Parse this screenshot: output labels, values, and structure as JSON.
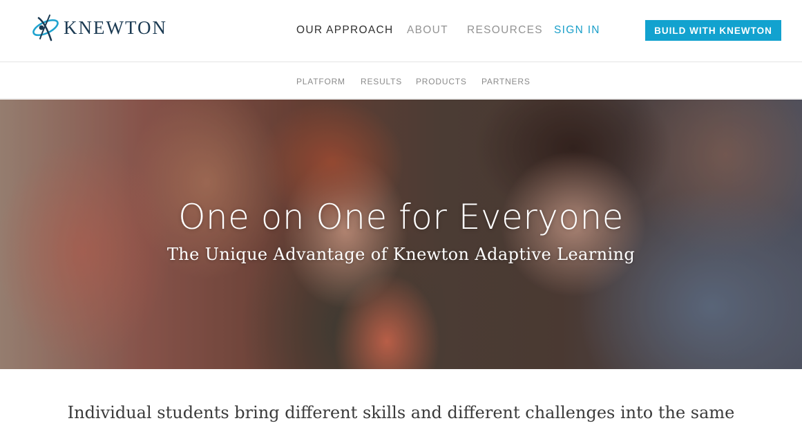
{
  "brand": {
    "name": "KNEWTON",
    "logo_icon": "atom-orbit-icon",
    "colors": {
      "accent": "#12a2cf",
      "signin": "#1a9fc9",
      "logo_text": "#1b3a52"
    }
  },
  "nav": {
    "items": [
      {
        "label": "OUR APPROACH",
        "active": true
      },
      {
        "label": "ABOUT",
        "active": false
      },
      {
        "label": "RESOURCES",
        "active": false
      }
    ],
    "signin_label": "SIGN IN",
    "cta_label": "BUILD WITH KNEWTON"
  },
  "subnav": {
    "items": [
      {
        "label": "PLATFORM"
      },
      {
        "label": "RESULTS"
      },
      {
        "label": "PRODUCTS"
      },
      {
        "label": "PARTNERS"
      }
    ]
  },
  "hero": {
    "title": "One on One for Everyone",
    "subtitle": "The Unique Advantage of Knewton Adaptive Learning"
  },
  "intro": {
    "text": "Individual students bring different skills and different challenges into the same"
  }
}
